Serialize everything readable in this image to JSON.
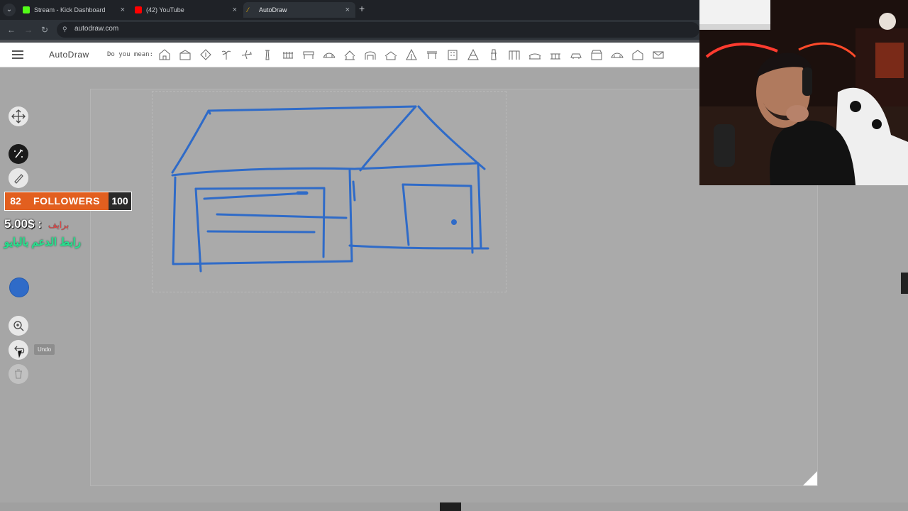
{
  "browser": {
    "tabs": [
      {
        "title": "Stream - Kick Dashboard",
        "favicon_color": "#53fc18",
        "active": false
      },
      {
        "title": "(42) YouTube",
        "favicon_color": "#ff0000",
        "active": false
      },
      {
        "title": "AutoDraw",
        "favicon_color": "#f4b400",
        "active": true
      }
    ],
    "close_glyph": "×",
    "new_tab_glyph": "+",
    "url": "autodraw.com"
  },
  "header": {
    "app_title": "AutoDraw",
    "suggestions_label": "Do you mean:",
    "suggestion_icons": [
      "house-icon",
      "barn-icon",
      "shed-icon",
      "palm-tree-icon",
      "airplane-icon",
      "lighthouse-icon",
      "fence-icon",
      "bench-icon",
      "bridge-icon",
      "bus-stop-icon",
      "garage-icon",
      "shelter-icon",
      "tent-icon",
      "table-icon",
      "building-icon",
      "pyramid-icon",
      "tower-icon",
      "gate-icon",
      "bridge-icon",
      "wall-icon",
      "car-icon",
      "store-icon",
      "stadium-icon",
      "house-icon",
      "envelope-icon"
    ]
  },
  "toolbar": {
    "tools": [
      "move-icon",
      "autodraw-icon",
      "draw-icon",
      "fill-icon",
      "shape-icon",
      "color-icon",
      "zoom-icon",
      "undo-icon",
      "delete-icon"
    ],
    "selected_color": "#2f6bc8",
    "undo_tooltip": "Undo"
  },
  "overlay": {
    "followers_count": "82",
    "followers_label": "FOLLOWERS",
    "followers_goal": "100",
    "donation_amount": "5.00$ :",
    "donation_name": "برايف",
    "donation_link": "رابط الدعم بالبايو",
    "followers_color": "#e25f1f",
    "link_color": "#27e38f"
  },
  "drawing": {
    "stroke_color": "#2f6bc8",
    "subject": "house-with-garage"
  }
}
